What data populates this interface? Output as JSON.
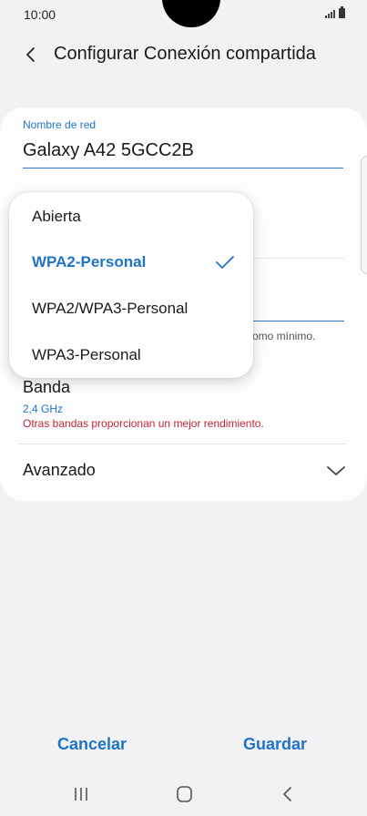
{
  "status_bar": {
    "time": "10:00"
  },
  "header": {
    "title": "Configurar Conexión compartida"
  },
  "network_name": {
    "label": "Nombre de red",
    "value": "Galaxy A42 5GCC2B"
  },
  "password": {
    "hint_partial": "omo mínimo."
  },
  "security_dropdown": {
    "options": [
      "Abierta",
      "WPA2-Personal",
      "WPA2/WPA3-Personal",
      "WPA3-Personal"
    ],
    "selected": "WPA2-Personal"
  },
  "band": {
    "label": "Banda",
    "value": "2,4 GHz",
    "note": "Otras bandas proporcionan un mejor rendimiento."
  },
  "advanced": {
    "label": "Avanzado"
  },
  "actions": {
    "cancel_label": "Cancelar",
    "save_label": "Guardar"
  },
  "colors": {
    "accent": "#1f74c9",
    "warning": "#c3253a",
    "background": "#f2f2f4"
  }
}
